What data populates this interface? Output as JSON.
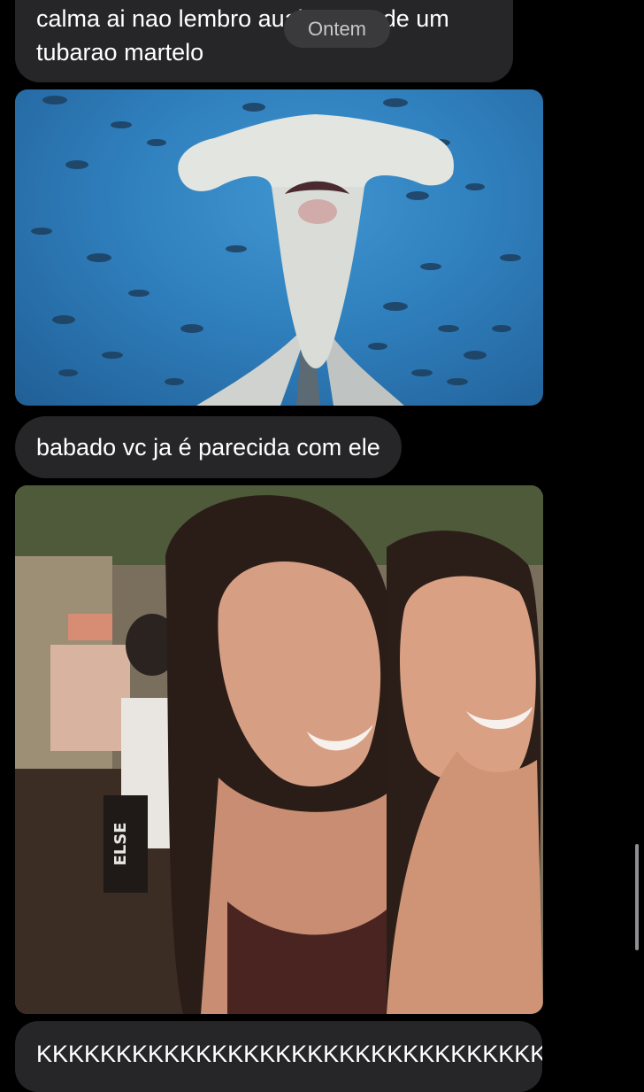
{
  "messages": [
    {
      "type": "text",
      "lines": [
        "calma ai nao lembro aual a cara de um",
        "tubarao martelo"
      ],
      "timestamp": "Ontem"
    },
    {
      "type": "image",
      "subject": "hammerhead shark"
    },
    {
      "type": "text",
      "text": "babado vc ja é parecida com ele"
    },
    {
      "type": "image",
      "subject": "selfie"
    },
    {
      "type": "text",
      "text": "KKKKKKKKKKKKKKKKKKKKKKKKKKKKKKKK"
    }
  ],
  "photo_lettering": "ELSE",
  "colors": {
    "background": "#000000",
    "bubble": "#262628",
    "bubble_text": "#ffffff",
    "time_pill": "#3a3a3c",
    "scrollbar": "#8e8e93"
  }
}
